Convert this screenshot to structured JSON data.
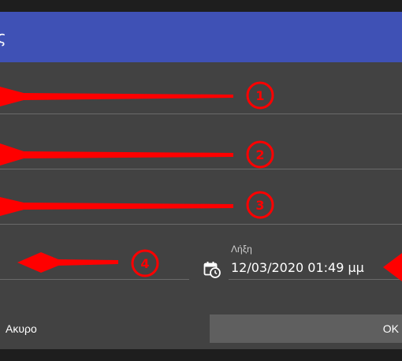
{
  "dialog": {
    "header_title": "ς",
    "end_date": {
      "label": "Λήξη",
      "value": "12/03/2020 01:49 μμ"
    },
    "actions": {
      "cancel_label": "Ακυρο",
      "ok_label": "OK"
    }
  },
  "annotations": {
    "markers": [
      "1",
      "2",
      "3",
      "4"
    ],
    "color": "#ff0000"
  },
  "colors": {
    "header": "#3f51b5",
    "dialog_bg": "#424242",
    "ok_button_bg": "#5f5f5f"
  },
  "icons": {
    "calendar": "calendar-clock-icon"
  }
}
